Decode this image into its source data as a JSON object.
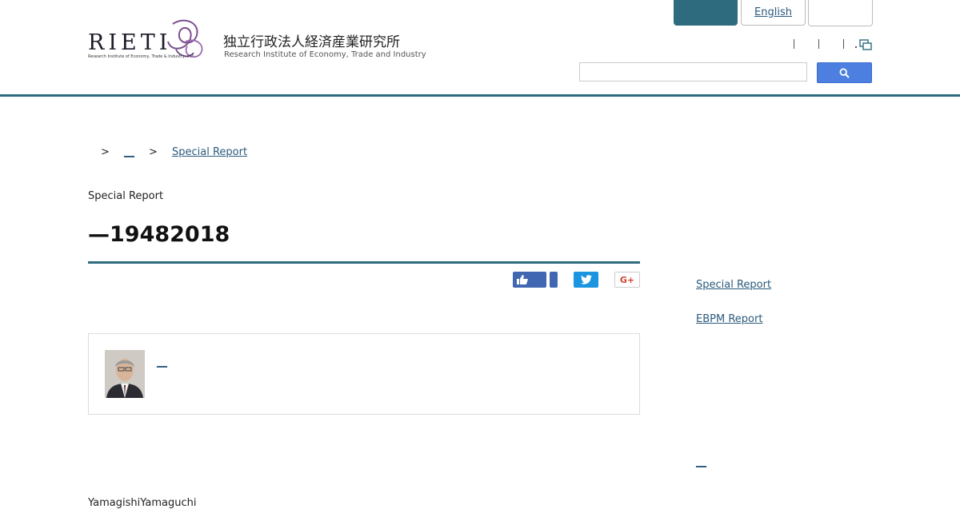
{
  "header": {
    "logo_text": "RIETI",
    "logo_sub": "Research Institute of Economy, Trade & Industry, IAA",
    "org_name_jp": "独立行政法人経済産業研究所",
    "org_name_en": "Research Institute of Economy, Trade and Industry",
    "lang_english": "English",
    "search_placeholder": "",
    "search_icon": "search-icon",
    "util_icon": "multi-window-icon",
    "brand_color": "#2e6b7e",
    "search_button_color": "#4d7fe0"
  },
  "breadcrumb": {
    "sep1": ">",
    "item1": "__",
    "sep2": ">",
    "item2": "Special Report"
  },
  "article": {
    "section": "Special Report",
    "title": "—19482018",
    "author_link": "__",
    "body_start": "YamagishiYamaguchi"
  },
  "share": {
    "facebook_icon": "thumbs-up-icon",
    "twitter_icon": "twitter-bird-icon",
    "gplus_label": "G+"
  },
  "sidebar": {
    "link1": "Special Report",
    "link2": "EBPM Report",
    "link3": "__"
  }
}
